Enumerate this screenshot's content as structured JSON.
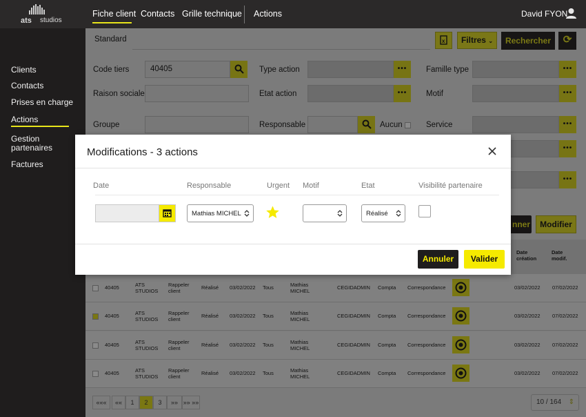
{
  "brand": {
    "logo_main": "ats",
    "logo_sub": "studios"
  },
  "topnav": {
    "items": [
      "Fiche client",
      "Contacts",
      "Grille technique"
    ],
    "actions": "Actions",
    "user": "David FYON"
  },
  "sidebar": {
    "items": [
      "Clients",
      "Contacts",
      "Prises en charge",
      "Actions"
    ],
    "gestion_line1": "Gestion",
    "gestion_line2": "partenaires",
    "factures": "Factures"
  },
  "filters": {
    "tab": "Standard",
    "filtres_label": "Filtres",
    "rechercher_label": "Rechercher",
    "code_tiers_label": "Code tiers",
    "code_tiers_value": "40405",
    "raison_sociale_label": "Raison sociale",
    "groupe_label": "Groupe",
    "type_action_label": "Type action",
    "etat_action_label": "Etat action",
    "responsable_label": "Responsable",
    "aucun_label": "Aucun",
    "famille_type_label": "Famille type",
    "motif_label": "Motif",
    "service_label": "Service",
    "dots": "•••"
  },
  "results": {
    "partial_button": "nner",
    "modifier_label": "Modifier",
    "col_date_creation_1": "Date",
    "col_date_creation_2": "création",
    "col_date_modif_1": "Date",
    "col_date_modif_2": "modif.",
    "rows": [
      {
        "code": "40405",
        "client1": "ATS",
        "client2": "STUDIOS",
        "type1": "Rappeler",
        "type2": "client",
        "etat": "Réalisé",
        "date": "03/02/2022",
        "pour": "Tous",
        "resp1": "Mathias",
        "resp2": "MICHEL",
        "createur": "CEGIDADMIN",
        "service": "Compta",
        "motif": "Correspondance",
        "created": "03/02/2022",
        "modified": "07/02/2022",
        "checked": false
      },
      {
        "code": "40405",
        "client1": "ATS",
        "client2": "STUDIOS",
        "type1": "Rappeler",
        "type2": "client",
        "etat": "Réalisé",
        "date": "03/02/2022",
        "pour": "Tous",
        "resp1": "Mathias",
        "resp2": "MICHEL",
        "createur": "CEGIDADMIN",
        "service": "Compta",
        "motif": "Correspondance",
        "created": "03/02/2022",
        "modified": "07/02/2022",
        "checked": true
      },
      {
        "code": "40405",
        "client1": "ATS",
        "client2": "STUDIOS",
        "type1": "Rappeler",
        "type2": "client",
        "etat": "Réalisé",
        "date": "03/02/2022",
        "pour": "Tous",
        "resp1": "Mathias",
        "resp2": "MICHEL",
        "createur": "CEGIDADMIN",
        "service": "Compta",
        "motif": "Correspondance",
        "created": "03/02/2022",
        "modified": "07/02/2022",
        "checked": false
      },
      {
        "code": "40405",
        "client1": "ATS",
        "client2": "STUDIOS",
        "type1": "Rappeler",
        "type2": "client",
        "etat": "Réalisé",
        "date": "03/02/2022",
        "pour": "Tous",
        "resp1": "Mathias",
        "resp2": "MICHEL",
        "createur": "CEGIDADMIN",
        "service": "Compta",
        "motif": "Correspondance",
        "created": "03/02/2022",
        "modified": "07/02/2022",
        "checked": false
      }
    ]
  },
  "pager": {
    "first": "«««",
    "prev": "««",
    "pages": [
      "1",
      "2",
      "3"
    ],
    "current": "2",
    "next": "»»",
    "last": "»» »»",
    "per_page": "10 / 164"
  },
  "modal": {
    "title": "Modifications - 3 actions",
    "headers": {
      "date": "Date",
      "responsable": "Responsable",
      "urgent": "Urgent",
      "motif": "Motif",
      "etat": "Etat",
      "visibilite": "Visibilité partenaire"
    },
    "responsable_value": "Mathias MICHEL",
    "motif_value": "",
    "etat_value": "Réalisé",
    "date_value": "",
    "urgent": true,
    "visibilite_checked": false,
    "annuler_label": "Annuler",
    "valider_label": "Valider"
  },
  "colors": {
    "accent_yellow": "#f5ea00",
    "dark": "#1f1d1d",
    "topbar": "#2b2929"
  }
}
